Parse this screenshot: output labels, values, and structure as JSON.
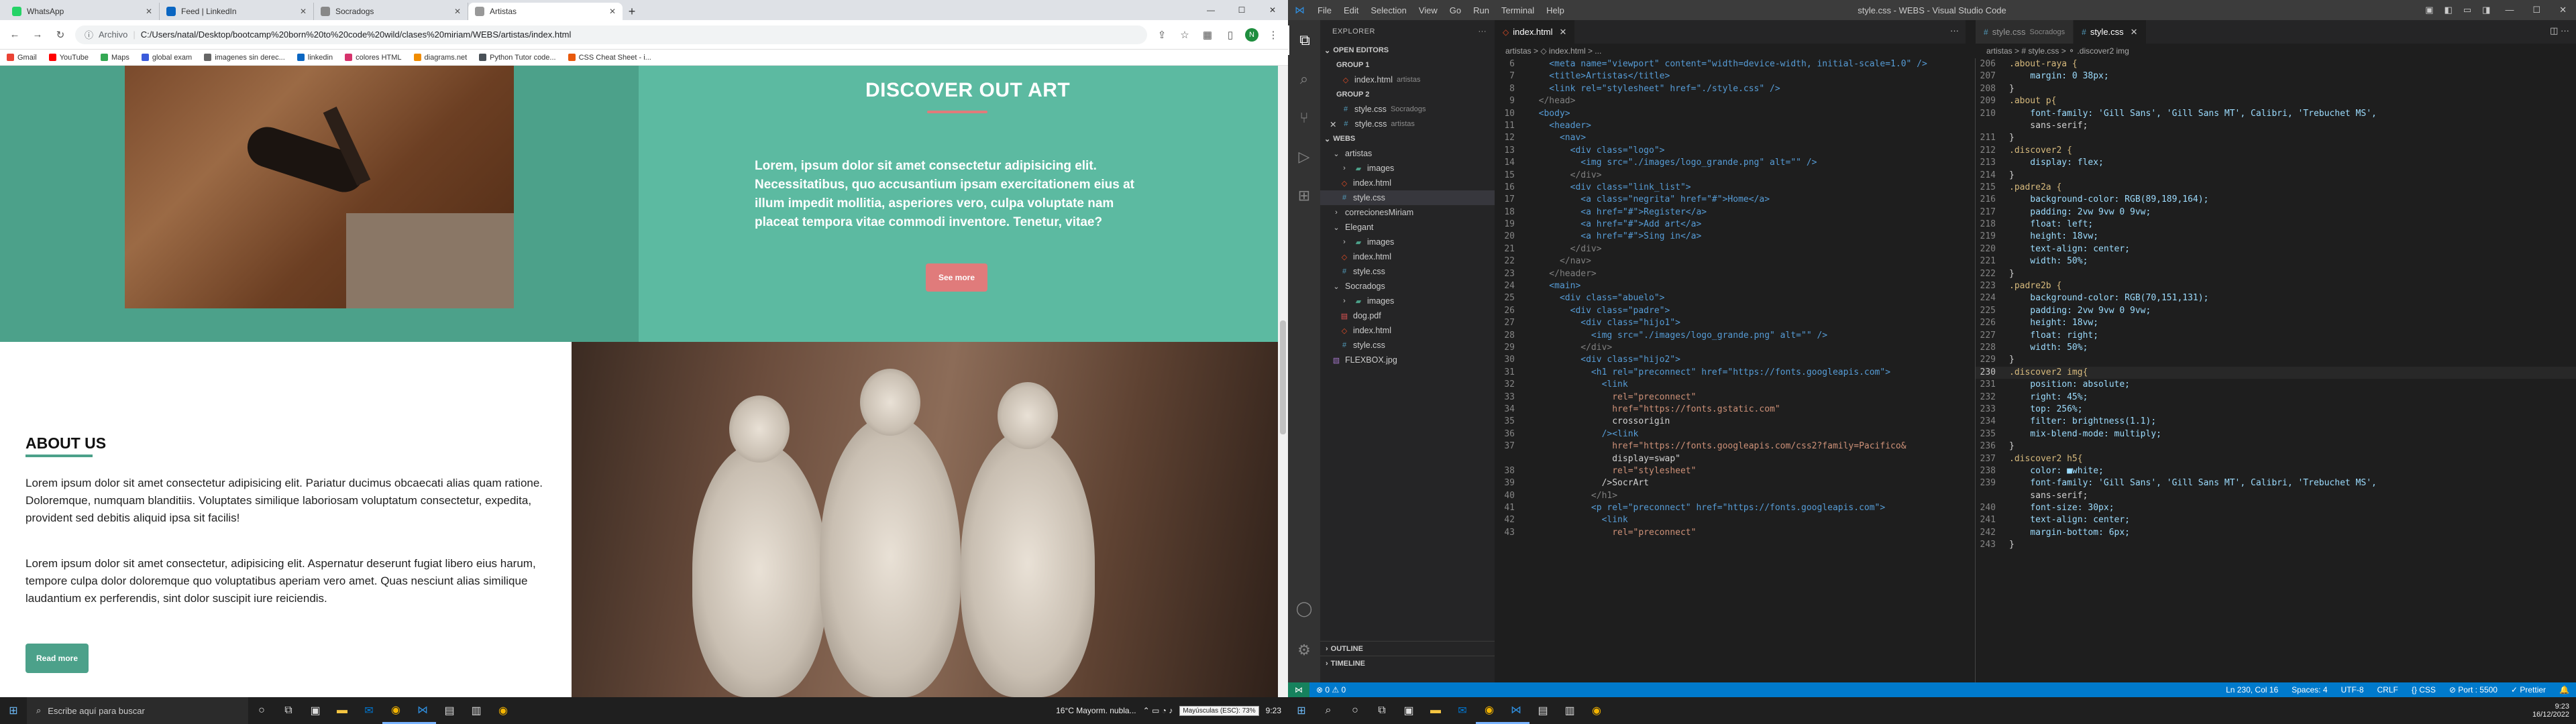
{
  "browser": {
    "tabs": [
      {
        "title": "WhatsApp",
        "color": "#25d366"
      },
      {
        "title": "Feed | LinkedIn",
        "color": "#0a66c2"
      },
      {
        "title": "Socradogs",
        "color": "#888888"
      },
      {
        "title": "Artistas",
        "color": "#999999"
      }
    ],
    "url_prefix": "Archivo",
    "url": "C:/Users/natal/Desktop/bootcamp%20born%20to%20code%20wild/clases%20miriam/WEBS/artistas/index.html",
    "bookmarks": [
      {
        "label": "Gmail",
        "color": "#ea4335"
      },
      {
        "label": "YouTube",
        "color": "#ff0000"
      },
      {
        "label": "Maps",
        "color": "#34a853"
      },
      {
        "label": "global exam",
        "color": "#3b5bdb"
      },
      {
        "label": "imagenes sin derec...",
        "color": "#666666"
      },
      {
        "label": "linkedin",
        "color": "#0a66c2"
      },
      {
        "label": "colores HTML",
        "color": "#d6336c"
      },
      {
        "label": "diagrams.net",
        "color": "#f08c00"
      },
      {
        "label": "Python Tutor code...",
        "color": "#495057"
      },
      {
        "label": "CSS Cheat Sheet - i...",
        "color": "#e8590c"
      }
    ]
  },
  "site": {
    "discover_title": "DISCOVER OUT ART",
    "discover_text": "Lorem, ipsum dolor sit amet consectetur adipisicing elit. Necessitatibus, quo accusantium ipsam exercitationem eius at illum impedit mollitia, asperiores vero, culpa voluptate nam placeat tempora vitae commodi inventore. Tenetur, vitae?",
    "see_more": "See more",
    "about_title": "ABOUT US",
    "about_p1": "Lorem ipsum dolor sit amet consectetur adipisicing elit. Pariatur ducimus obcaecati alias quam ratione. Doloremque, numquam blanditiis. Voluptates similique laboriosam voluptatum consectetur, expedita, provident sed debitis aliquid ipsa sit facilis!",
    "about_p2": "Lorem ipsum dolor sit amet consectetur, adipisicing elit. Aspernatur deserunt fugiat libero eius harum, tempore culpa dolor doloremque quo voluptatibus aperiam vero amet. Quas nesciunt alias similique laudantium ex perferendis, sint dolor suscipit iure reiciendis.",
    "read_more": "Read more"
  },
  "taskbar_left": {
    "search_placeholder": "Escribe aquí para buscar",
    "weather": "16°C  Mayorm. nubla...",
    "time": "9:23",
    "tooltip": "Mayúsculas (ESC): 73%"
  },
  "vscode": {
    "menu": [
      "File",
      "Edit",
      "Selection",
      "View",
      "Go",
      "Run",
      "Terminal",
      "Help"
    ],
    "title": "style.css - WEBS - Visual Studio Code",
    "explorer_title": "EXPLORER",
    "open_editors": "OPEN EDITORS",
    "group1": "GROUP 1",
    "group2": "GROUP 2",
    "open_files": [
      {
        "group": 1,
        "name": "index.html",
        "desc": "artistas",
        "type": "html"
      },
      {
        "group": 2,
        "name": "style.css",
        "desc": "Socradogs",
        "type": "css"
      },
      {
        "group": 2,
        "name": "style.css",
        "desc": "artistas",
        "type": "css",
        "close": "✕"
      }
    ],
    "workspace": "WEBS",
    "tree": [
      {
        "indent": 1,
        "label": "artistas",
        "kind": "folder-open"
      },
      {
        "indent": 2,
        "label": "images",
        "kind": "folder"
      },
      {
        "indent": 2,
        "label": "index.html",
        "kind": "html"
      },
      {
        "indent": 2,
        "label": "style.css",
        "kind": "css",
        "selected": true
      },
      {
        "indent": 1,
        "label": "correcionesMiriam",
        "kind": "folder"
      },
      {
        "indent": 1,
        "label": "Elegant",
        "kind": "folder-open"
      },
      {
        "indent": 2,
        "label": "images",
        "kind": "folder"
      },
      {
        "indent": 2,
        "label": "index.html",
        "kind": "html"
      },
      {
        "indent": 2,
        "label": "style.css",
        "kind": "css"
      },
      {
        "indent": 1,
        "label": "Socradogs",
        "kind": "folder-open"
      },
      {
        "indent": 2,
        "label": "images",
        "kind": "folder"
      },
      {
        "indent": 2,
        "label": "dog.pdf",
        "kind": "pdf"
      },
      {
        "indent": 2,
        "label": "index.html",
        "kind": "html"
      },
      {
        "indent": 2,
        "label": "style.css",
        "kind": "css"
      },
      {
        "indent": 1,
        "label": "FLEXBOX.jpg",
        "kind": "image"
      }
    ],
    "outline": "OUTLINE",
    "timeline": "TIMELINE",
    "left_editor": {
      "tab": "index.html",
      "crumb": "artistas > ◇ index.html > ...",
      "lines": [
        {
          "n": "6",
          "t": "    <meta name=\"viewport\" content=\"width=device-width, initial-scale=1.0\" />"
        },
        {
          "n": "7",
          "t": "    <title>Artistas</title>"
        },
        {
          "n": "8",
          "t": "    <link rel=\"stylesheet\" href=\"./style.css\" />"
        },
        {
          "n": "9",
          "t": "  </head>"
        },
        {
          "n": "10",
          "t": "  <body>"
        },
        {
          "n": "11",
          "t": "    <header>"
        },
        {
          "n": "12",
          "t": "      <nav>"
        },
        {
          "n": "13",
          "t": "        <div class=\"logo\">"
        },
        {
          "n": "14",
          "t": "          <img src=\"./images/logo_grande.png\" alt=\"\" />"
        },
        {
          "n": "15",
          "t": "        </div>"
        },
        {
          "n": "16",
          "t": "        <div class=\"link_list\">"
        },
        {
          "n": "17",
          "t": "          <a class=\"negrita\" href=\"#\">Home</a>"
        },
        {
          "n": "18",
          "t": "          <a href=\"#\">Register</a>"
        },
        {
          "n": "19",
          "t": "          <a href=\"#\">Add art</a>"
        },
        {
          "n": "20",
          "t": "          <a href=\"#\">Sing in</a>"
        },
        {
          "n": "21",
          "t": "        </div>"
        },
        {
          "n": "22",
          "t": "      </nav>"
        },
        {
          "n": "23",
          "t": "    </header>"
        },
        {
          "n": "24",
          "t": "    <main>"
        },
        {
          "n": "25",
          "t": "      <div class=\"abuelo\">"
        },
        {
          "n": "26",
          "t": "        <div class=\"padre\">"
        },
        {
          "n": "27",
          "t": "          <div class=\"hijo1\">"
        },
        {
          "n": "28",
          "t": "            <img src=\"./images/logo_grande.png\" alt=\"\" />"
        },
        {
          "n": "29",
          "t": "          </div>"
        },
        {
          "n": "30",
          "t": "          <div class=\"hijo2\">"
        },
        {
          "n": "31",
          "t": "            <h1 rel=\"preconnect\" href=\"https://fonts.googleapis.com\">"
        },
        {
          "n": "32",
          "t": "              <link"
        },
        {
          "n": "33",
          "t": "                rel=\"preconnect\""
        },
        {
          "n": "34",
          "t": "                href=\"https://fonts.gstatic.com\""
        },
        {
          "n": "35",
          "t": "                crossorigin"
        },
        {
          "n": "36",
          "t": "              /><link"
        },
        {
          "n": "37",
          "t": "                href=\"https://fonts.googleapis.com/css2?family=Pacifico&"
        },
        {
          "n": "",
          "t": "                display=swap\""
        },
        {
          "n": "38",
          "t": "                rel=\"stylesheet\""
        },
        {
          "n": "39",
          "t": "              />SocrArt"
        },
        {
          "n": "40",
          "t": "            </h1>"
        },
        {
          "n": "41",
          "t": "            <p rel=\"preconnect\" href=\"https://fonts.googleapis.com\">"
        },
        {
          "n": "42",
          "t": "              <link"
        },
        {
          "n": "43",
          "t": "                rel=\"preconnect\""
        }
      ]
    },
    "right_editor": {
      "tabs": [
        "style.css",
        "style.css"
      ],
      "tab_descs": [
        "Socradogs",
        ""
      ],
      "crumb": "artistas > # style.css > ⚬ .discover2 img",
      "lines": [
        {
          "n": "206",
          "t": ".about-raya {"
        },
        {
          "n": "207",
          "t": "    margin: 0 38px;"
        },
        {
          "n": "208",
          "t": "}"
        },
        {
          "n": "209",
          "t": ".about p{"
        },
        {
          "n": "210",
          "t": "    font-family: 'Gill Sans', 'Gill Sans MT', Calibri, 'Trebuchet MS',"
        },
        {
          "n": "",
          "t": "    sans-serif;"
        },
        {
          "n": "211",
          "t": "}"
        },
        {
          "n": "212",
          "t": ".discover2 {"
        },
        {
          "n": "213",
          "t": "    display: flex;"
        },
        {
          "n": "214",
          "t": "}"
        },
        {
          "n": "215",
          "t": ".padre2a {"
        },
        {
          "n": "216",
          "t": "    background-color: RGB(89,189,164);"
        },
        {
          "n": "217",
          "t": "    padding: 2vw 9vw 0 9vw;"
        },
        {
          "n": "218",
          "t": "    float: left;"
        },
        {
          "n": "219",
          "t": "    height: 18vw;"
        },
        {
          "n": "220",
          "t": "    text-align: center;"
        },
        {
          "n": "221",
          "t": "    width: 50%;"
        },
        {
          "n": "222",
          "t": "}"
        },
        {
          "n": "223",
          "t": ".padre2b {"
        },
        {
          "n": "224",
          "t": "    background-color: RGB(70,151,131);"
        },
        {
          "n": "225",
          "t": "    padding: 2vw 9vw 0 9vw;"
        },
        {
          "n": "226",
          "t": "    height: 18vw;"
        },
        {
          "n": "227",
          "t": "    float: right;"
        },
        {
          "n": "228",
          "t": "    width: 50%;"
        },
        {
          "n": "229",
          "t": "}"
        },
        {
          "n": "230",
          "t": ".discover2 img{",
          "cur": true
        },
        {
          "n": "231",
          "t": "    position: absolute;"
        },
        {
          "n": "232",
          "t": "    right: 45%;"
        },
        {
          "n": "233",
          "t": "    top: 256%;"
        },
        {
          "n": "234",
          "t": "    filter: brightness(1.1);"
        },
        {
          "n": "235",
          "t": "    mix-blend-mode: multiply;"
        },
        {
          "n": "236",
          "t": "}"
        },
        {
          "n": "237",
          "t": ".discover2 h5{"
        },
        {
          "n": "238",
          "t": "    color: ■white;"
        },
        {
          "n": "239",
          "t": "    font-family: 'Gill Sans', 'Gill Sans MT', Calibri, 'Trebuchet MS',"
        },
        {
          "n": "",
          "t": "    sans-serif;"
        },
        {
          "n": "240",
          "t": "    font-size: 30px;"
        },
        {
          "n": "241",
          "t": "    text-align: center;"
        },
        {
          "n": "242",
          "t": "    margin-bottom: 6px;"
        },
        {
          "n": "243",
          "t": "}"
        }
      ]
    },
    "status_left": [
      "⊗ 0  ⚠ 0"
    ],
    "status_right": [
      "Ln 230, Col 16",
      "Spaces: 4",
      "UTF-8",
      "CRLF",
      "{} CSS",
      "⊘ Port : 5500",
      "✓ Prettier",
      "🔔"
    ]
  },
  "taskbar_right": {
    "time": "9:23",
    "date": "16/12/2022"
  }
}
